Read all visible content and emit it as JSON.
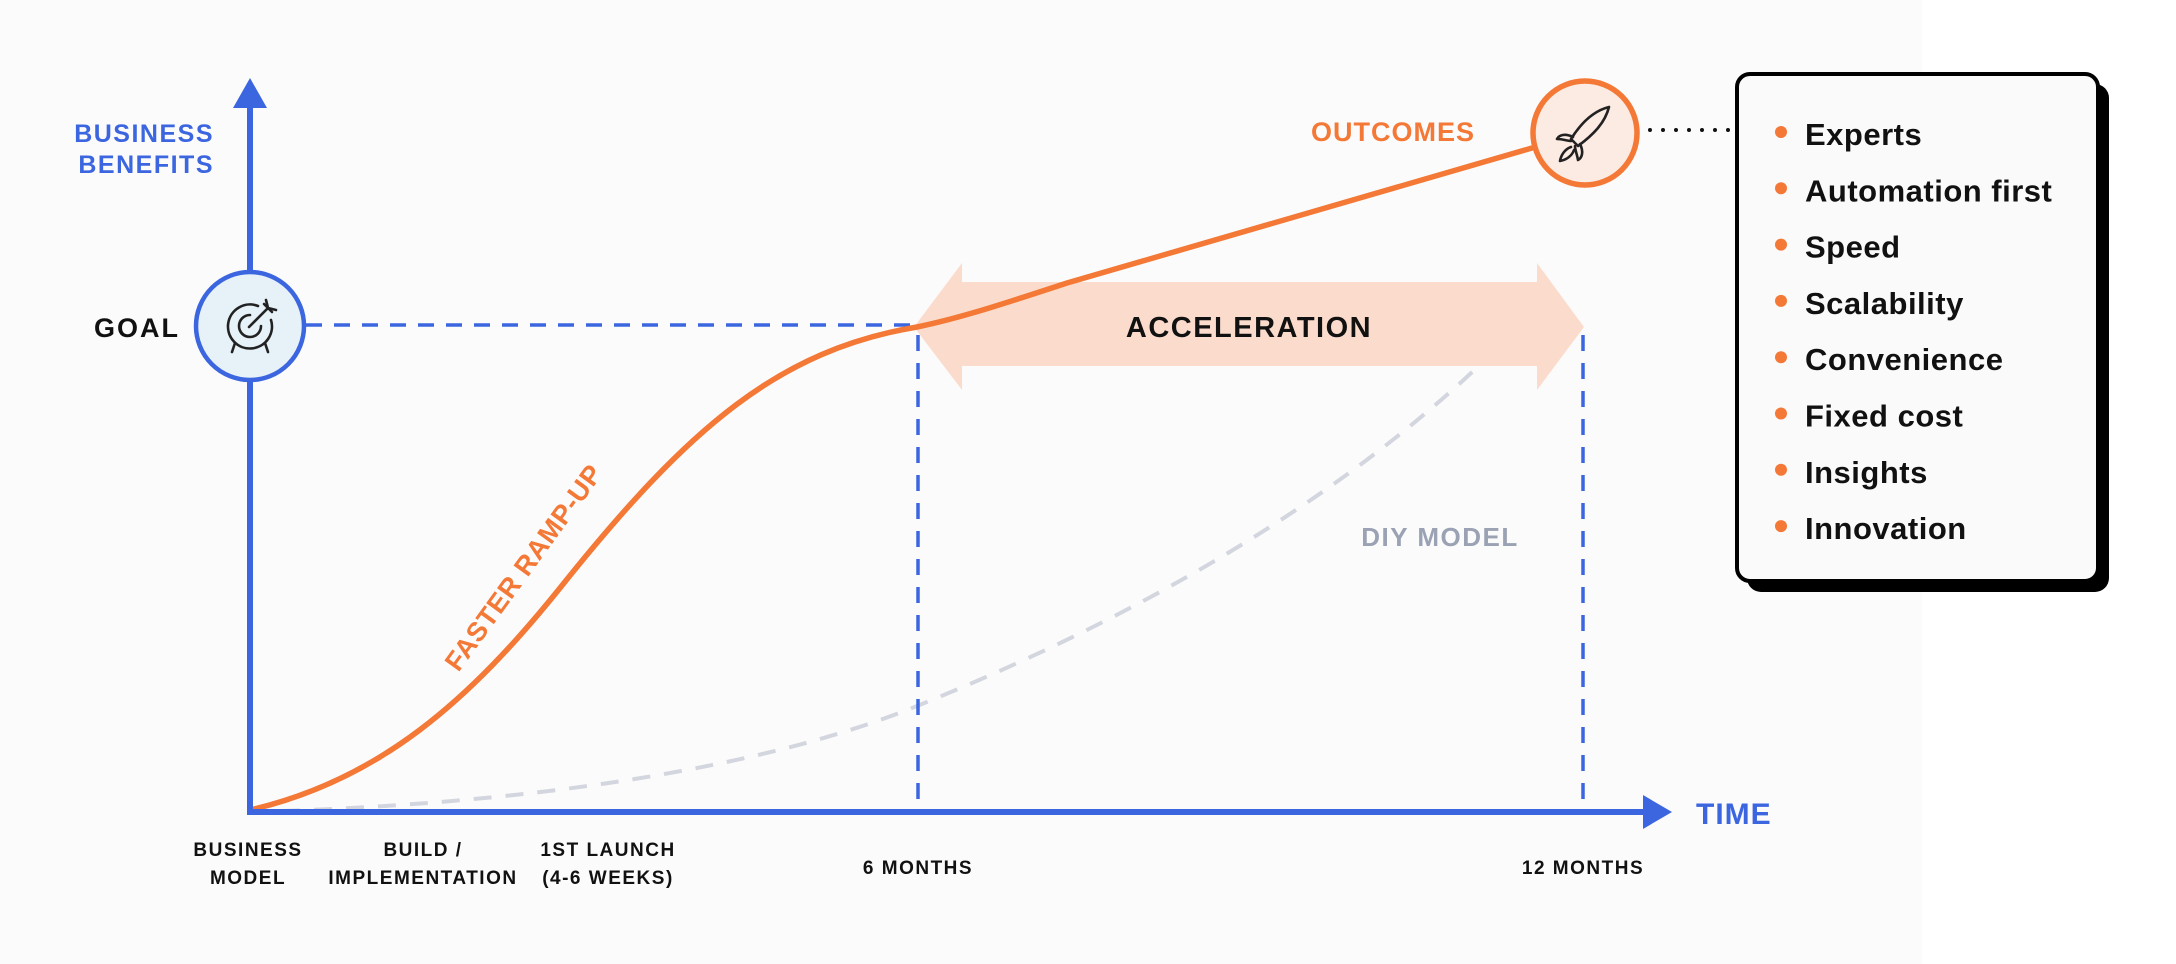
{
  "diagram": {
    "y_axis_label": [
      "BUSINESS",
      "BENEFITS"
    ],
    "x_axis_label": "TIME",
    "goal_label": "GOAL",
    "outcomes_label": "OUTCOMES",
    "acceleration_label": "ACCELERATION",
    "ramp_label": "FASTER RAMP-UP",
    "diy_label": "DIY MODEL",
    "x_ticks": [
      {
        "lines": [
          "BUSINESS",
          "MODEL"
        ]
      },
      {
        "lines": [
          "BUILD /",
          "IMPLEMENTATION"
        ]
      },
      {
        "lines": [
          "1ST LAUNCH",
          "(4-6 WEEKS)"
        ]
      },
      {
        "lines": [
          "6 MONTHS"
        ]
      },
      {
        "lines": [
          "12 MONTHS"
        ]
      }
    ],
    "icons": {
      "goal": "target-icon",
      "outcomes": "rocket-icon"
    },
    "colors": {
      "axis_blue": "#3b66e0",
      "ramp_orange": "#f47836",
      "acceleration_fill": "#fbdccc",
      "diy_gray": "#d3d6de",
      "diy_text": "#9aa2b4"
    }
  },
  "outcomes_list": {
    "items": [
      "Experts",
      "Automation first",
      "Speed",
      "Scalability",
      "Convenience",
      "Fixed cost",
      "Insights",
      "Innovation"
    ]
  }
}
